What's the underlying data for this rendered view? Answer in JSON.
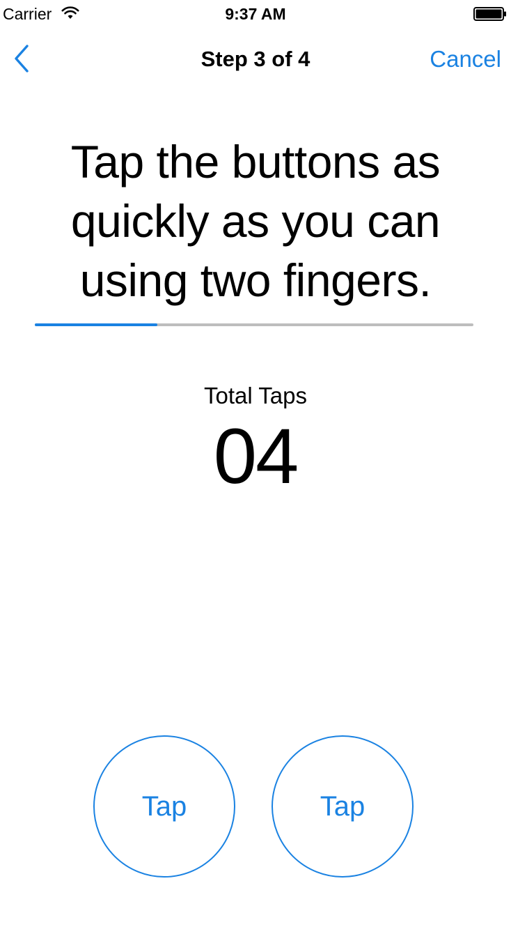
{
  "status_bar": {
    "carrier": "Carrier",
    "time": "9:37 AM",
    "wifi_icon": "wifi-icon",
    "battery_icon": "battery-icon"
  },
  "nav": {
    "back_icon": "chevron-left-icon",
    "title": "Step 3 of 4",
    "cancel_label": "Cancel"
  },
  "instruction": "Tap the buttons as quickly as you can using two fingers.",
  "progress": {
    "fraction": 0.28
  },
  "taps": {
    "label": "Total Taps",
    "count": "04"
  },
  "buttons": {
    "left_label": "Tap",
    "right_label": "Tap"
  },
  "colors": {
    "accent": "#1A82E2",
    "track": "#BDBDBD",
    "text": "#000000",
    "background": "#FFFFFF"
  }
}
